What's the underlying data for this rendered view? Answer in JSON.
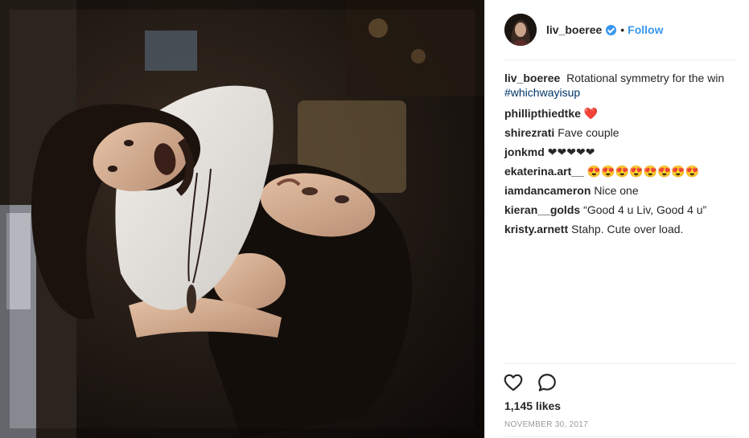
{
  "post": {
    "username": "liv_boeree",
    "separator": "•",
    "follow_label": "Follow",
    "caption": {
      "username": "liv_boeree",
      "text": "Rotational symmetry for the win",
      "hashtag": "#whichwayisup"
    },
    "comments": [
      {
        "username": "phillipthiedtke",
        "text": "❤️"
      },
      {
        "username": "shirezrati",
        "text": "Fave couple"
      },
      {
        "username": "jonkmd",
        "text": "❤❤❤❤❤"
      },
      {
        "username": "ekaterina.art__",
        "text": "😍😍😍😍😍😍😍😍"
      },
      {
        "username": "iamdancameron",
        "text": "Nice one"
      },
      {
        "username": "kieran__golds",
        "text": "“Good 4 u Liv, Good 4 u”"
      },
      {
        "username": "kristy.arnett",
        "text": "Stahp. Cute over load."
      }
    ],
    "likes": "1,145 likes",
    "date": "NOVEMBER 30, 2017"
  },
  "icons": {
    "like": "heart-outline-icon",
    "comment": "speech-bubble-icon",
    "verified": "verified-badge-icon"
  },
  "colors": {
    "accent": "#3897f0",
    "hashtag": "#003569",
    "muted": "#999999",
    "text": "#262626"
  }
}
